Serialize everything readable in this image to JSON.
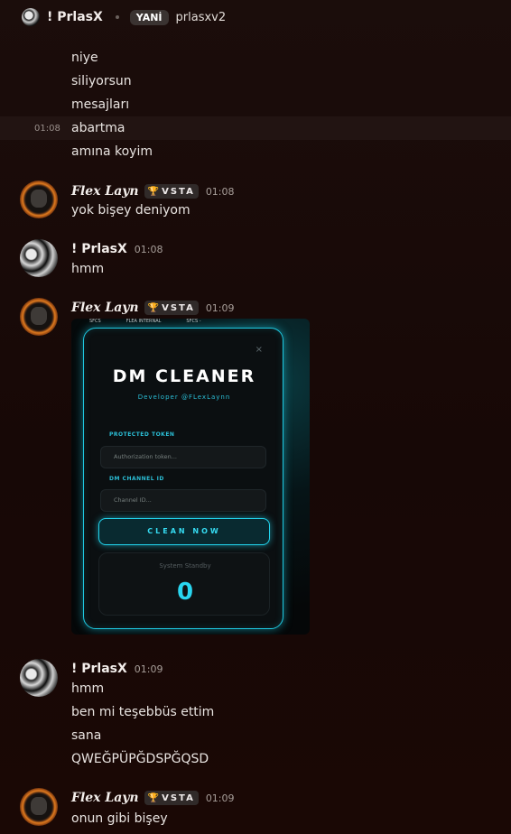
{
  "header": {
    "name": "! PrlasX",
    "tag": "YANİ",
    "subtitle": "prlasxv2"
  },
  "messages": {
    "top_lines": [
      "niye",
      "siliyorsun",
      "mesajları",
      "abartma",
      "amına koyim"
    ],
    "hover_time": "01:08",
    "flex_name": "Flex Layn",
    "badge_text": "VSTA",
    "prl_name": "! PrlasX",
    "m1_time": "01:08",
    "m1_text": "yok bişey deniyom",
    "m2_time": "01:08",
    "m2_text": "hmm",
    "m3_time": "01:09",
    "m4_time": "01:09",
    "m4_lines": [
      "hmm",
      "ben mi teşebbüs ettim",
      "sana",
      "QWEĞPÜPĞDSPĞQSD"
    ],
    "m5_time": "01:09",
    "m5_text": "onun gibi bişey"
  },
  "embed": {
    "top_labels": [
      "SFCS",
      "FLEA INTERNAL",
      "SFCS -"
    ],
    "close": "×",
    "title": "DM CLEANER",
    "developer": "Developer @FLexLaynn",
    "token_label": "PROTECTED TOKEN",
    "token_placeholder": "Authorization token...",
    "channel_label": "DM CHANNEL ID",
    "channel_placeholder": "Channel ID...",
    "button": "CLEAN NOW",
    "status": "System Standby",
    "counter": "0"
  },
  "colors": {
    "accent": "#1ec8e0",
    "badge_trophy": "#c9a2f2",
    "background": "#1b0d0b"
  },
  "icons": {
    "badge": "trophy-icon",
    "close": "close-icon"
  }
}
